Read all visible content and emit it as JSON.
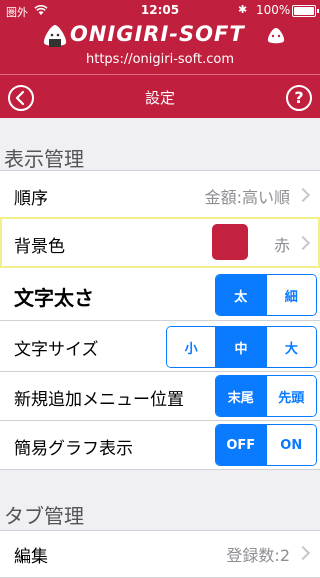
{
  "status": {
    "carrier": "圏外",
    "time": "12:05",
    "battery": "100%"
  },
  "brand": {
    "logo": "ONIGIRI-SOFT",
    "url": "https://onigiri-soft.com"
  },
  "nav": {
    "title": "設定",
    "back_icon": "chevron-left-circle-icon",
    "help_icon": "question-circle-icon",
    "help_glyph": "?"
  },
  "sections": {
    "display": "表示管理",
    "tabs": "タブ管理"
  },
  "rows": {
    "order": {
      "label": "順序",
      "value": "金額:高い順"
    },
    "bgcolor": {
      "label": "背景色",
      "value": "赤",
      "swatch": "#c4213f"
    },
    "bold": {
      "label": "文字太さ",
      "options": [
        "太",
        "細"
      ]
    },
    "size": {
      "label": "文字サイズ",
      "options": [
        "小",
        "中",
        "大"
      ]
    },
    "position": {
      "label": "新規追加メニュー位置",
      "options": [
        "末尾",
        "先頭"
      ]
    },
    "graph": {
      "label": "簡易グラフ表示",
      "options": [
        "OFF",
        "ON"
      ]
    },
    "edit": {
      "label": "編集",
      "value": "登録数:2"
    }
  },
  "colors": {
    "brand": "#c0203e",
    "accent": "#0a7aff"
  }
}
